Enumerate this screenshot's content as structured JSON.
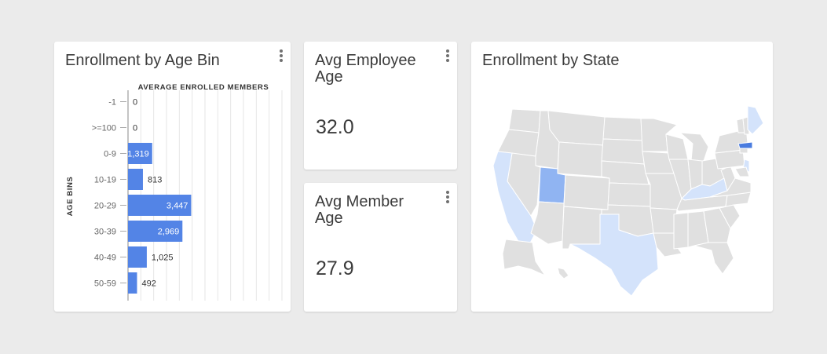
{
  "cards": {
    "age_bin": {
      "title": "Enrollment by Age Bin"
    },
    "employee_age": {
      "title": "Avg Employee\nAge",
      "value": "32.0"
    },
    "member_age": {
      "title": "Avg Member\nAge",
      "value": "27.9"
    },
    "state": {
      "title": "Enrollment by State"
    }
  },
  "icons": {
    "card_menu": "more-vertical-icon"
  },
  "colors": {
    "bar": "#5384e6",
    "map_base": "#e0e0e0",
    "map_light": "#d4e3fb",
    "map_mid": "#90b4f2",
    "map_dark": "#4a7cdf"
  },
  "chart_data": {
    "type": "bar",
    "orientation": "horizontal",
    "title": "Enrollment by Age Bin",
    "xlabel": "AVERAGE ENROLLED MEMBERS",
    "ylabel": "AGE BINS",
    "categories": [
      "-1",
      ">=100",
      "0-9",
      "10-19",
      "20-29",
      "30-39",
      "40-49",
      "50-59"
    ],
    "values": [
      0,
      0,
      1319,
      813,
      3447,
      2969,
      1025,
      492
    ],
    "value_labels": [
      "0",
      "0",
      "1,319",
      "813",
      "3,447",
      "2,969",
      "1,025",
      "492"
    ],
    "xlim": [
      0,
      8400
    ],
    "grid": true
  },
  "map_data": {
    "highlighted_states": [
      {
        "state": "UT",
        "level": "mid"
      },
      {
        "state": "CA",
        "level": "light"
      },
      {
        "state": "TX",
        "level": "light"
      },
      {
        "state": "KY",
        "level": "light"
      },
      {
        "state": "ME",
        "level": "light"
      },
      {
        "state": "NJ",
        "level": "light"
      },
      {
        "state": "MA",
        "level": "dark"
      }
    ]
  }
}
